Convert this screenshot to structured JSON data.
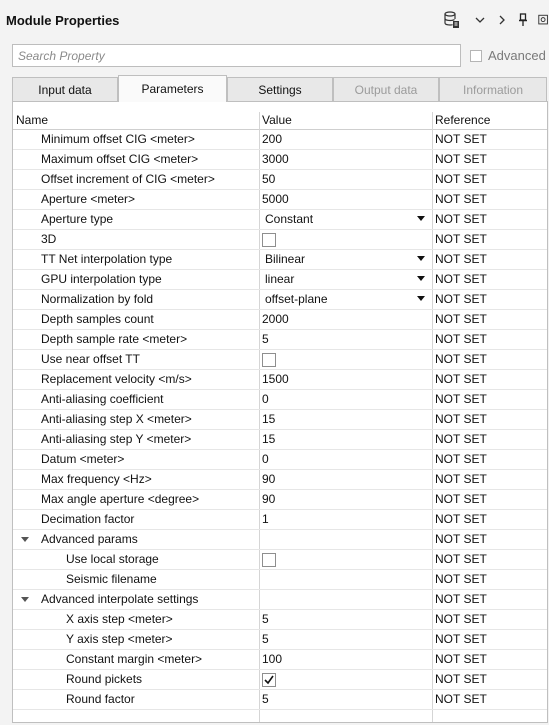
{
  "panel": {
    "title": "Module Properties"
  },
  "toolbar": {
    "icons": [
      "database-settings-icon",
      "chevron-down-icon",
      "chevron-right-icon",
      "pin-icon",
      "float-window-icon"
    ]
  },
  "search": {
    "placeholder": "Search Property"
  },
  "advanced": {
    "label": "Advanced",
    "checked": false
  },
  "tabs": [
    {
      "label": "Input data",
      "state": "normal"
    },
    {
      "label": "Parameters",
      "state": "active"
    },
    {
      "label": "Settings",
      "state": "normal"
    },
    {
      "label": "Output data",
      "state": "disabled"
    },
    {
      "label": "Information",
      "state": "disabled"
    }
  ],
  "grid": {
    "columns": [
      "Name",
      "Value",
      "Reference"
    ],
    "rows": [
      {
        "name": "Minimum offset CIG <meter>",
        "value": "200",
        "reference": "NOT SET"
      },
      {
        "name": "Maximum offset CIG <meter>",
        "value": "3000",
        "reference": "NOT SET"
      },
      {
        "name": "Offset increment of CIG <meter>",
        "value": "50",
        "reference": "NOT SET"
      },
      {
        "name": "Aperture <meter>",
        "value": "5000",
        "reference": "NOT SET"
      },
      {
        "name": "Aperture type",
        "value": "Constant",
        "type": "dropdown",
        "reference": "NOT SET"
      },
      {
        "name": "3D",
        "type": "checkbox",
        "checked": false,
        "reference": "NOT SET"
      },
      {
        "name": "TT Net interpolation type",
        "value": "Bilinear",
        "type": "dropdown",
        "reference": "NOT SET"
      },
      {
        "name": "GPU interpolation type",
        "value": "linear",
        "type": "dropdown",
        "reference": "NOT SET"
      },
      {
        "name": "Normalization by fold",
        "value": "offset-plane",
        "type": "dropdown",
        "reference": "NOT SET"
      },
      {
        "name": "Depth samples count",
        "value": "2000",
        "reference": "NOT SET"
      },
      {
        "name": "Depth sample rate <meter>",
        "value": "5",
        "reference": "NOT SET"
      },
      {
        "name": "Use near offset TT",
        "type": "checkbox",
        "checked": false,
        "reference": "NOT SET"
      },
      {
        "name": "Replacement velocity <m/s>",
        "value": "1500",
        "reference": "NOT SET"
      },
      {
        "name": "Anti-aliasing coefficient",
        "value": "0",
        "reference": "NOT SET"
      },
      {
        "name": "Anti-aliasing step X <meter>",
        "value": "15",
        "reference": "NOT SET"
      },
      {
        "name": "Anti-aliasing step Y <meter>",
        "value": "15",
        "reference": "NOT SET"
      },
      {
        "name": "Datum <meter>",
        "value": "0",
        "reference": "NOT SET"
      },
      {
        "name": "Max frequency <Hz>",
        "value": "90",
        "reference": "NOT SET"
      },
      {
        "name": "Max angle aperture <degree>",
        "value": "90",
        "reference": "NOT SET"
      },
      {
        "name": "Decimation factor",
        "value": "1",
        "reference": "NOT SET"
      },
      {
        "name": "Advanced params",
        "type": "group",
        "expanded": true,
        "reference": "NOT SET"
      },
      {
        "name": "Use local storage",
        "type": "checkbox",
        "checked": false,
        "level": 1,
        "reference": "NOT SET"
      },
      {
        "name": "Seismic filename",
        "value": "",
        "level": 1,
        "reference": "NOT SET"
      },
      {
        "name": "Advanced interpolate settings",
        "type": "group",
        "expanded": true,
        "reference": "NOT SET"
      },
      {
        "name": "X axis step <meter>",
        "value": "5",
        "level": 1,
        "reference": "NOT SET"
      },
      {
        "name": "Y axis step <meter>",
        "value": "5",
        "level": 1,
        "reference": "NOT SET"
      },
      {
        "name": "Constant margin <meter>",
        "value": "100",
        "level": 1,
        "reference": "NOT SET"
      },
      {
        "name": "Round pickets",
        "type": "checkbox",
        "checked": true,
        "level": 1,
        "reference": "NOT SET"
      },
      {
        "name": "Round factor",
        "value": "5",
        "level": 1,
        "reference": "NOT SET"
      }
    ]
  },
  "colors": {
    "background": "#f3f3f3",
    "grid_background": "#ffffff",
    "border": "#bfbfbf",
    "disabled_text": "#9b9b9b"
  }
}
